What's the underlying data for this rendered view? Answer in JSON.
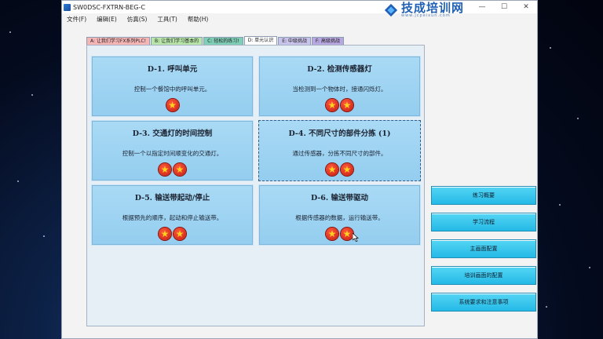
{
  "window": {
    "title": "SW0DSC-FXTRN-BEG-C",
    "controls": {
      "minimize": "—",
      "maximize": "☐",
      "close": "✕"
    }
  },
  "logo": {
    "text": "技成培训网",
    "url": "www.jcpeixun.com"
  },
  "menu": [
    "文件(F)",
    "编辑(E)",
    "仿真(S)",
    "工具(T)",
    "帮助(H)"
  ],
  "tabs": [
    {
      "label": "A: 让我们学习FX系列PLC!",
      "color": "#f6b6b6",
      "active": false
    },
    {
      "label": "B: 让我们学习基本的",
      "color": "#b8e6a8",
      "active": false
    },
    {
      "label": "C: 轻松的练习!",
      "color": "#7fcfb6",
      "active": false
    },
    {
      "label": "D: 单元认识",
      "color": "#ffffff",
      "active": true
    },
    {
      "label": "E: 中级挑战",
      "color": "#c9c2ea",
      "active": false
    },
    {
      "label": "F: 高级挑战",
      "color": "#b8a7e0",
      "active": false
    }
  ],
  "cards": [
    {
      "title": "D-1. 呼叫单元",
      "desc": "控制一个餐馆中的呼叫单元。",
      "stars": 1
    },
    {
      "title": "D-2. 检测传感器灯",
      "desc": "当检测到一个物体时，接通闪烁灯。",
      "stars": 2
    },
    {
      "title": "D-3. 交通灯的时间控制",
      "desc": "控制一个以指定时间顺变化的交通灯。",
      "stars": 2
    },
    {
      "title": "D-4. 不同尺寸的部件分拣 (1)",
      "desc": "通过传感器，分拣不同尺寸的部件。",
      "stars": 2
    },
    {
      "title": "D-5. 输送带起动/停止",
      "desc": "根据预先的顺序，起动和停止输送带。",
      "stars": 2
    },
    {
      "title": "D-6. 输送带驱动",
      "desc": "根据传感器的数据，运行输送带。",
      "stars": 2
    }
  ],
  "side_buttons": [
    "练习概要",
    "学习流程",
    "主画面配置",
    "培训画面的配置",
    "系统要求和注意事项"
  ],
  "icons": {
    "star": "★",
    "app": "app-icon",
    "logo": "logo-icon"
  }
}
